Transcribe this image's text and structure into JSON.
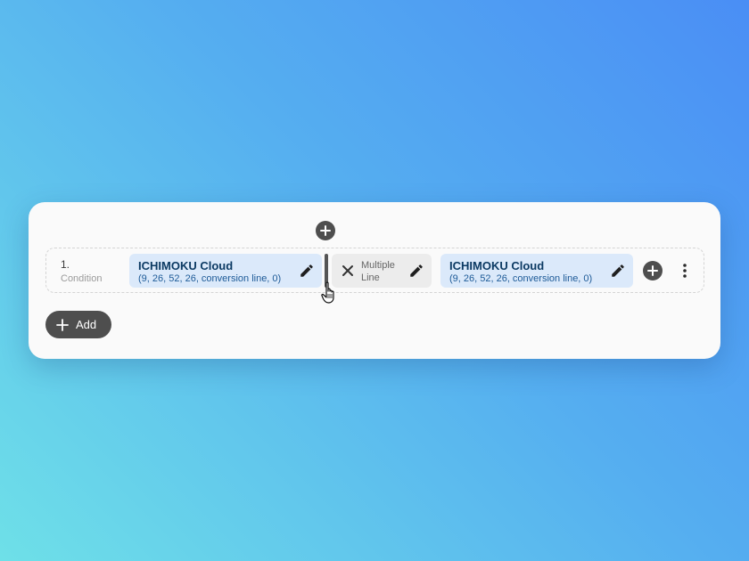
{
  "condition": {
    "index": "1.",
    "label": "Condition",
    "left_indicator": {
      "name": "ICHIMOKU Cloud",
      "params": "(9, 26, 52, 26, conversion line, 0)"
    },
    "operator": {
      "label": "Multiple Line"
    },
    "right_indicator": {
      "name": "ICHIMOKU Cloud",
      "params": "(9, 26, 52, 26, conversion line, 0)"
    }
  },
  "add_button": {
    "label": "Add"
  },
  "icons": {
    "insert": "plus-circle-icon",
    "edit": "pencil-icon",
    "remove": "close-icon",
    "more": "more-vertical-icon",
    "cursor": "hand-pointer-icon"
  },
  "colors": {
    "chip_bg": "#dbe9fa",
    "chip_text": "#0c3a63",
    "button_dark": "#4e4e4e"
  }
}
